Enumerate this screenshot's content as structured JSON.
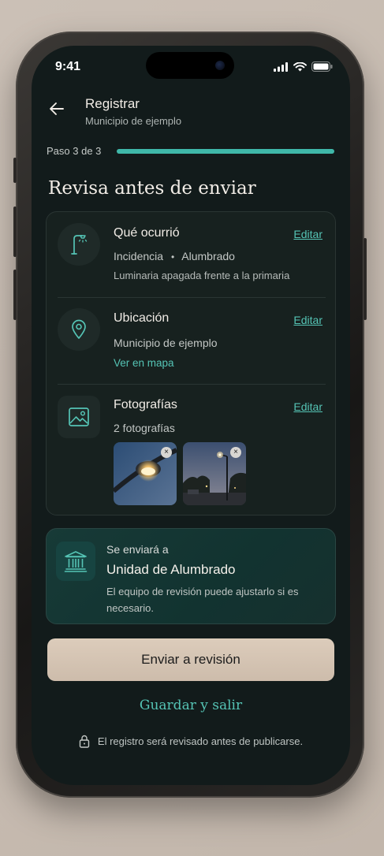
{
  "status_bar": {
    "time": "9:41"
  },
  "header": {
    "title": "Registrar",
    "subtitle": "Municipio de ejemplo"
  },
  "progress": {
    "label": "Paso 3 de 3",
    "fraction": 1.0
  },
  "page_title": "Revisa antes de enviar",
  "review": {
    "what": {
      "title": "Qué ocurrió",
      "edit": "Editar",
      "category": "Incidencia",
      "separator": "•",
      "subcategory": "Alumbrado",
      "description": "Luminaria apagada frente a la primaria"
    },
    "location": {
      "title": "Ubicación",
      "edit": "Editar",
      "place": "Municipio de ejemplo",
      "map_link": "Ver en mapa"
    },
    "photos": {
      "title": "Fotografías",
      "edit": "Editar",
      "count": "2 fotografías",
      "remove_glyph": "×"
    }
  },
  "destination": {
    "label": "Se enviará a",
    "unit": "Unidad de Alumbrado",
    "description": "El equipo de revisión puede ajustarlo si es necesario."
  },
  "actions": {
    "submit": "Enviar a revisión",
    "save": "Guardar y salir"
  },
  "footer_note": "El registro será revisado antes de publicarse.",
  "colors": {
    "accent": "#55c4b5",
    "background": "#121b1b",
    "button": "#d5c4b3"
  }
}
